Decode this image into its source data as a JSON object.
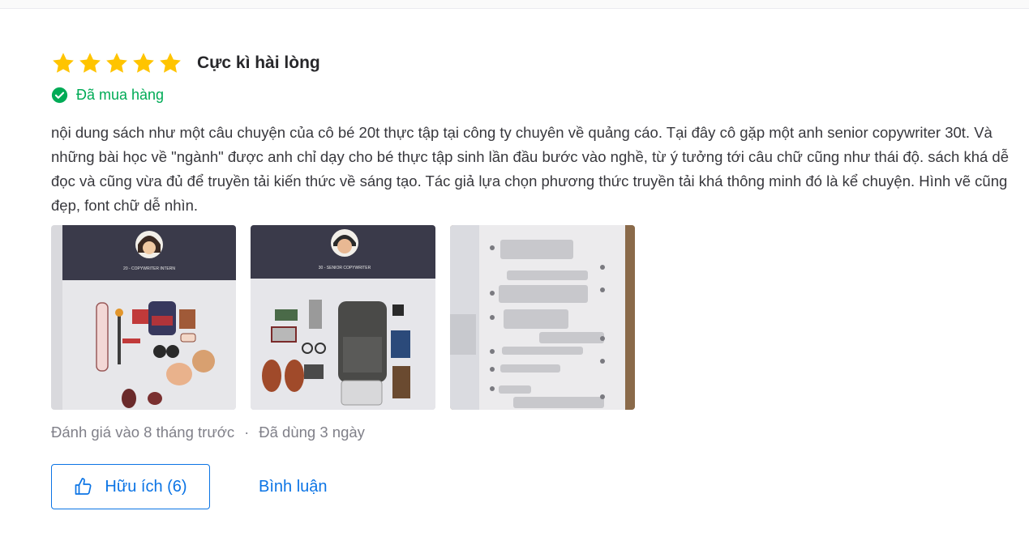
{
  "review": {
    "rating": 5,
    "rating_max": 5,
    "star_color": "#ffc400",
    "title": "Cực kì hài lòng",
    "purchased_label": "Đã mua hàng",
    "purchased_color": "#00ab56",
    "content": "nội dung sách như một câu chuyện của cô bé 20t thực tập tại công ty chuyên về quảng cáo. Tại đây cô gặp một anh senior copywriter 30t. Và những bài học về \"ngành\" được anh chỉ dạy cho bé thực tập sinh lần đầu bước vào nghề, từ ý tưởng tới câu chữ cũng như thái độ. sách khá dễ đọc và cũng vừa đủ để truyền tải kiến thức về sáng tạo. Tác giả lựa chọn phương thức truyền tải khá thông minh đó là kể chuyện. Hình vẽ cũng đẹp, font chữ dễ nhìn.",
    "images": [
      {
        "photo": "book-page-copywriter-intern",
        "caption": "20 - COPYWRITER INTERN"
      },
      {
        "photo": "book-page-senior-copywriter",
        "caption": "30 - SENIOR COPYWRITER"
      },
      {
        "photo": "book-page-chat-dialogue",
        "caption": ""
      }
    ],
    "meta": {
      "reviewed": "Đánh giá vào 8 tháng trước",
      "separator": "·",
      "used": "Đã dùng 3 ngày"
    },
    "actions": {
      "helpful_label": "Hữu ích (6)",
      "comment_label": "Bình luận",
      "accent_color": "#0b74e5"
    }
  }
}
